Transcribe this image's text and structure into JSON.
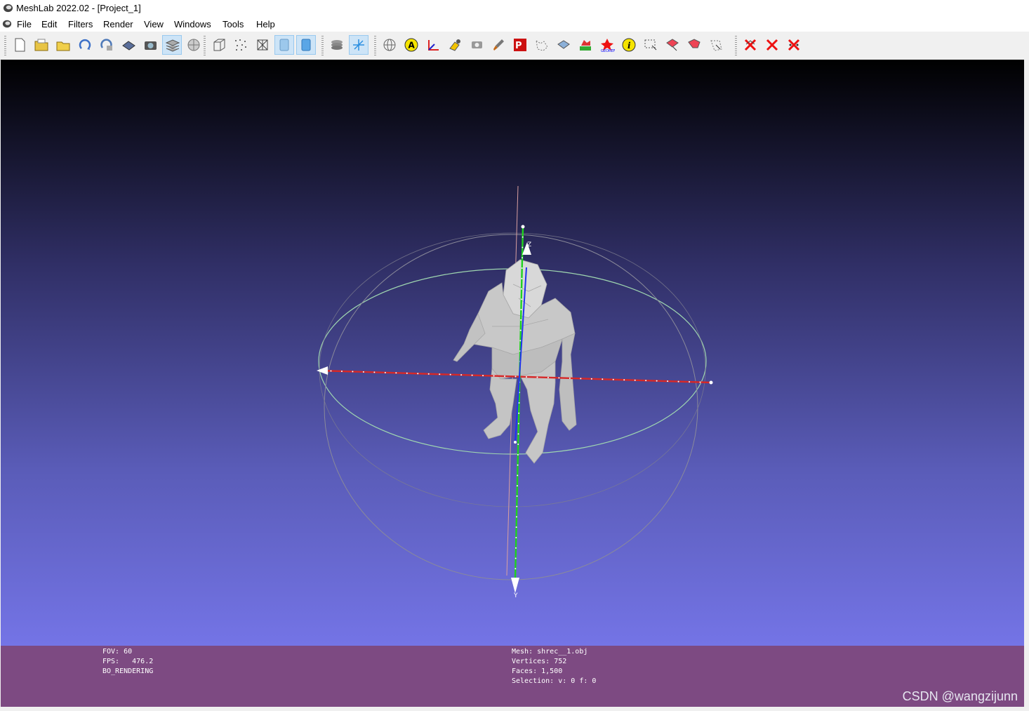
{
  "window": {
    "title": "MeshLab 2022.02 - [Project_1]"
  },
  "menu": [
    "File",
    "Edit",
    "Filters",
    "Render",
    "View",
    "Windows",
    "Tools",
    "Help"
  ],
  "toolbar": {
    "groups": [
      [
        "new-project-icon",
        "open-project-icon",
        "open-mesh-icon",
        "reload-icon",
        "reload-all-icon",
        "save-icon",
        "snapshot-icon",
        "layers-icon",
        "sphere-icon"
      ],
      [
        "bbox-icon",
        "points-icon",
        "wireframe-icon",
        "flat-icon",
        "smooth-icon"
      ],
      [
        "stack-icon",
        "axes-decorator-icon"
      ],
      [
        "globe-icon",
        "annotation-a-icon",
        "axis-icon",
        "paint-select-icon",
        "camera-icon",
        "brush-icon",
        "pp-icon",
        "select-vertices-icon",
        "select-faces-icon",
        "color-icon",
        "georef-icon",
        "info-icon",
        "select-rect-icon",
        "select-conn-icon",
        "select-poly-icon",
        "select-area-icon"
      ],
      [
        "delete-selected-icon",
        "delete-faces-icon",
        "delete-vertices-icon"
      ]
    ],
    "active": [
      "layers-icon",
      "flat-icon",
      "smooth-icon",
      "axes-decorator-icon"
    ]
  },
  "info_left": [
    "FOV: 60",
    "FPS:   476.2",
    "BO_RENDERING"
  ],
  "info_right": [
    "Mesh: shrec__1.obj",
    "Vertices: 752",
    "Faces: 1,500",
    "Selection: v: 0 f: 0"
  ],
  "axes": {
    "z_label": "Z",
    "y_label": "Y"
  },
  "watermark": "CSDN @wangzijunn",
  "colors": {
    "x_axis": "#d62828",
    "y_axis": "#1fd21f",
    "z_axis": "#2233ee",
    "info_bg": "#7d4a82"
  }
}
